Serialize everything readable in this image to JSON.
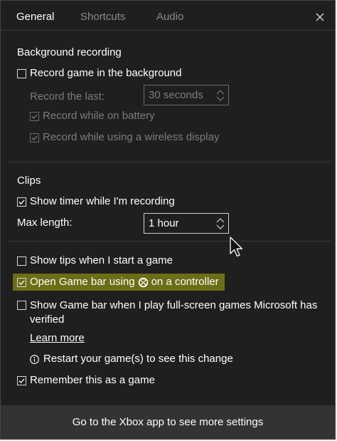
{
  "tabs": {
    "general": "General",
    "shortcuts": "Shortcuts",
    "audio": "Audio"
  },
  "background_recording": {
    "title": "Background recording",
    "record_in_background": {
      "label": "Record game in the background",
      "checked": false
    },
    "record_the_last_label": "Record the last:",
    "record_the_last_value": "30 seconds",
    "record_on_battery": {
      "label": "Record while on battery",
      "checked": true
    },
    "record_wireless_display": {
      "label": "Record while using a wireless display",
      "checked": true
    }
  },
  "clips": {
    "title": "Clips",
    "show_timer": {
      "label": "Show timer while I'm recording",
      "checked": true
    },
    "max_length_label": "Max length:",
    "max_length_value": "1 hour"
  },
  "misc": {
    "show_tips": {
      "label": "Show tips when I start a game",
      "checked": false
    },
    "open_game_bar_before": "Open Game bar using",
    "open_game_bar_after": "on a controller",
    "open_game_bar_checked": true,
    "show_fullscreen": {
      "label": "Show Game bar when I play full-screen games Microsoft has verified",
      "checked": false
    },
    "learn_more": "Learn more",
    "restart_note": "Restart your game(s) to see this change",
    "remember_game": {
      "label": "Remember this as a game",
      "checked": true
    }
  },
  "footer": {
    "label": "Go to the Xbox app to see more settings"
  },
  "colors": {
    "background": "#1f1f1f",
    "highlight": "#6b6e16",
    "footer": "#333333"
  },
  "icons": {
    "close": "close-icon",
    "info": "info-icon",
    "xbox": "xbox-icon",
    "checkmark": "checkmark-icon",
    "spinner": "spinner-arrows-icon",
    "cursor": "mouse-pointer-icon"
  }
}
